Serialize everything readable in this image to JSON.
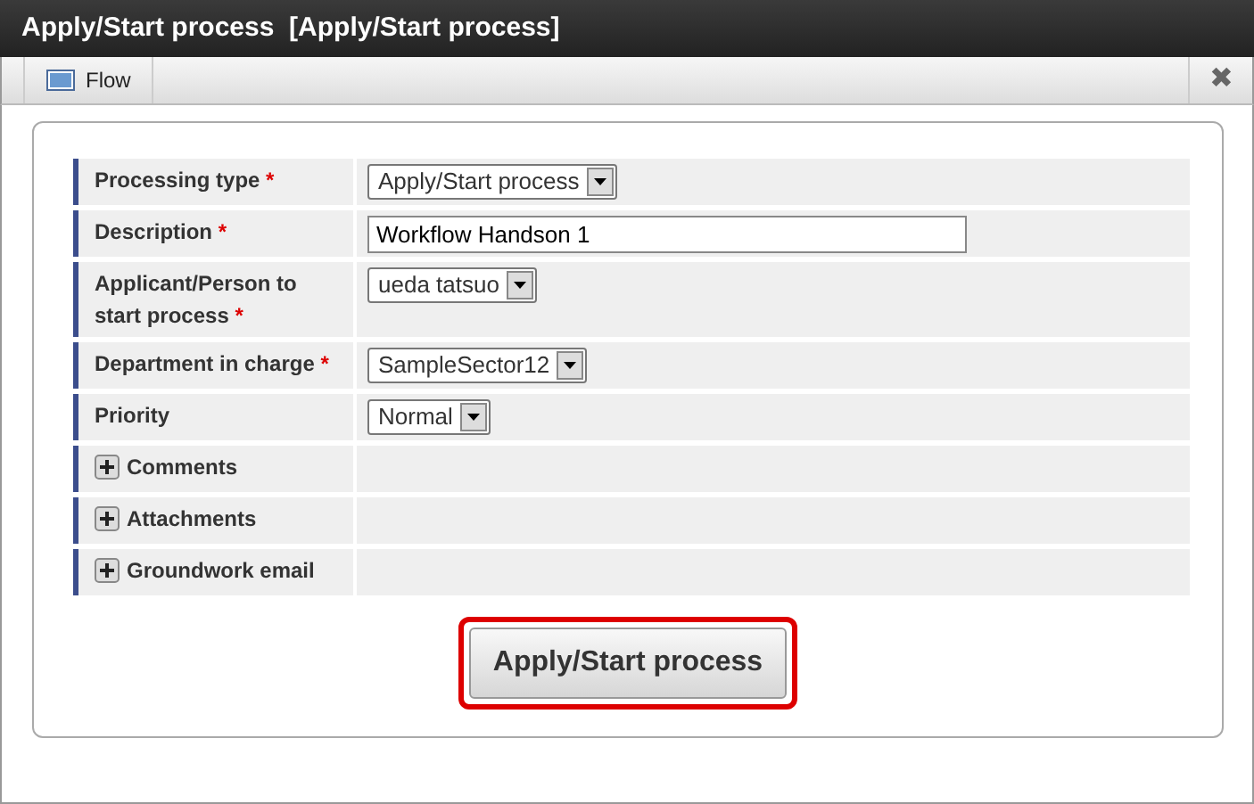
{
  "window": {
    "title": "Apply/Start process  [Apply/Start process]"
  },
  "tabs": [
    {
      "label": "Flow"
    }
  ],
  "close_button": {
    "label": "✖"
  },
  "form": {
    "rows": [
      {
        "kind": "select",
        "label": "Processing type",
        "required_mark": "*",
        "value": "Apply/Start process"
      },
      {
        "kind": "text",
        "label": "Description",
        "required_mark": "*",
        "value": "Workflow Handson 1"
      },
      {
        "kind": "select",
        "label": "Applicant/Person to start process",
        "required_mark": "*",
        "value": "ueda tatsuo"
      },
      {
        "kind": "select",
        "label": "Department in charge",
        "required_mark": "*",
        "value": "SampleSector12"
      },
      {
        "kind": "select",
        "label": "Priority",
        "value": "Normal"
      },
      {
        "kind": "section",
        "label": "Comments",
        "expanded": false
      },
      {
        "kind": "section",
        "label": "Attachments",
        "expanded": false
      },
      {
        "kind": "section",
        "label": "Groundwork email",
        "expanded": false
      }
    ]
  },
  "submit_button": {
    "label": "Apply/Start process",
    "highlighted": true
  }
}
